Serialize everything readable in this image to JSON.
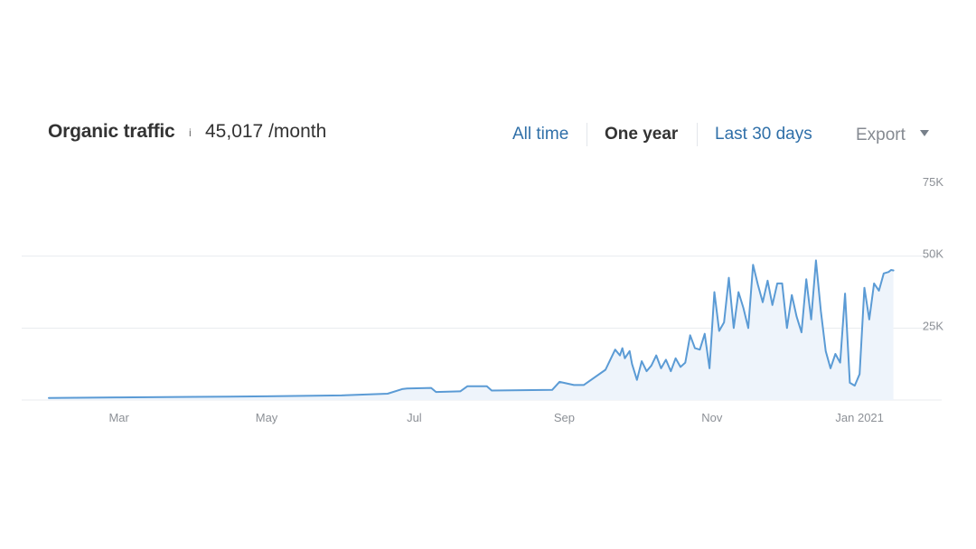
{
  "header": {
    "title": "Organic traffic",
    "info_icon": "i",
    "metric_value": "45,017 /month",
    "ranges": [
      "All time",
      "One year",
      "Last 30 days"
    ],
    "active_range": "One year",
    "export_label": "Export",
    "export_caret": "caret-down-icon"
  },
  "colors": {
    "line": "#5b9bd5",
    "area": "#eef4fb",
    "grid": "#e8ebef",
    "link": "#2f6fa8",
    "text": "#333333",
    "muted": "#8c9096"
  },
  "chart_data": {
    "type": "area",
    "title": "Organic traffic",
    "xlabel": "",
    "ylabel": "",
    "ylim": [
      0,
      75000
    ],
    "yticks": [
      25000,
      50000,
      75000
    ],
    "ytick_labels": [
      "25K",
      "50K",
      "75K"
    ],
    "xlim": [
      "2020-02-01",
      "2021-01-17"
    ],
    "xticks": [
      "2020-03-01",
      "2020-05-01",
      "2020-07-01",
      "2020-09-01",
      "2020-11-01",
      "2021-01-01"
    ],
    "xtick_labels": [
      "Mar",
      "May",
      "Jul",
      "Sep",
      "Nov",
      "Jan 2021"
    ],
    "grid": true,
    "legend": "none",
    "series": [
      {
        "x": [
          "2020-02-01",
          "2020-03-01",
          "2020-04-01",
          "2020-05-01",
          "2020-06-01",
          "2020-06-20",
          "2020-06-26",
          "2020-06-28",
          "2020-07-08",
          "2020-07-10",
          "2020-07-20",
          "2020-07-23",
          "2020-07-31",
          "2020-08-02",
          "2020-08-27",
          "2020-08-30",
          "2020-09-05",
          "2020-09-09",
          "2020-09-18",
          "2020-09-20",
          "2020-09-22",
          "2020-09-24",
          "2020-09-25",
          "2020-09-26",
          "2020-09-28",
          "2020-09-29",
          "2020-10-01",
          "2020-10-03",
          "2020-10-05",
          "2020-10-07",
          "2020-10-09",
          "2020-10-11",
          "2020-10-13",
          "2020-10-15",
          "2020-10-17",
          "2020-10-19",
          "2020-10-21",
          "2020-10-23",
          "2020-10-25",
          "2020-10-27",
          "2020-10-29",
          "2020-10-31",
          "2020-11-02",
          "2020-11-04",
          "2020-11-06",
          "2020-11-08",
          "2020-11-10",
          "2020-11-12",
          "2020-11-14",
          "2020-11-16",
          "2020-11-18",
          "2020-11-20",
          "2020-11-22",
          "2020-11-24",
          "2020-11-26",
          "2020-11-28",
          "2020-11-30",
          "2020-12-02",
          "2020-12-04",
          "2020-12-06",
          "2020-12-08",
          "2020-12-10",
          "2020-12-12",
          "2020-12-14",
          "2020-12-16",
          "2020-12-18",
          "2020-12-20",
          "2020-12-22",
          "2020-12-24",
          "2020-12-26",
          "2020-12-28",
          "2020-12-30",
          "2021-01-01",
          "2021-01-03",
          "2021-01-05",
          "2021-01-07",
          "2021-01-09",
          "2021-01-11",
          "2021-01-13",
          "2021-01-14",
          "2021-01-15"
        ],
        "values": [
          700,
          900,
          1100,
          1300,
          1600,
          2200,
          3800,
          4000,
          4200,
          2800,
          3000,
          4800,
          4800,
          3300,
          3500,
          6300,
          5200,
          5200,
          10500,
          14000,
          17500,
          15500,
          18000,
          14500,
          17000,
          12500,
          7000,
          13500,
          10000,
          12000,
          15500,
          11000,
          14000,
          10000,
          14500,
          11500,
          13000,
          22500,
          18000,
          17500,
          23000,
          11000,
          37500,
          24000,
          27000,
          42500,
          25000,
          37500,
          32000,
          25000,
          47000,
          40000,
          34000,
          41500,
          33000,
          40500,
          40500,
          25000,
          36500,
          29000,
          23500,
          42000,
          28000,
          48500,
          31000,
          17000,
          11000,
          16000,
          13000,
          37000,
          6000,
          5000,
          9000,
          39000,
          28000,
          40500,
          38000,
          44000,
          44500,
          45200,
          45017
        ]
      }
    ]
  }
}
